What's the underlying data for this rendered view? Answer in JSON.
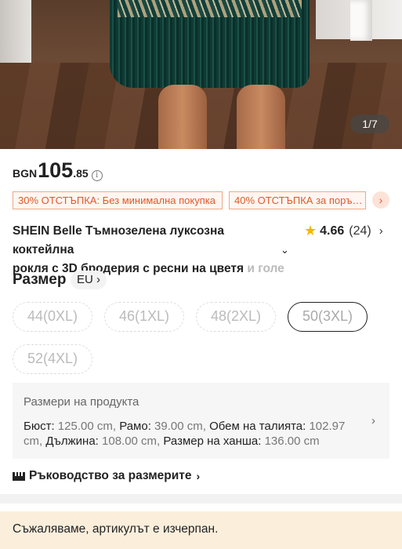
{
  "gallery": {
    "counter": "1/7"
  },
  "price": {
    "currency": "BGN",
    "main": "105",
    "decimal": ".85",
    "info_icon": "info-icon"
  },
  "promos": [
    "30% ОТСТЪПКА: Без минимална покупка",
    "40% ОТСТЪПКА за поръ…"
  ],
  "product": {
    "title_line1": "SHEIN Belle Тъмнозелена луксозна коктейлна",
    "title_line2_visible": "рокля с 3D бродерия с ресни на цветя",
    "title_line2_fade": " и голе",
    "rating": "4.66",
    "reviews": "(24)"
  },
  "size": {
    "label": "Размер",
    "unit": "EU",
    "options": [
      "44(0XL)",
      "46(1XL)",
      "48(2XL)",
      "50(3XL)",
      "52(4XL)"
    ],
    "selected_index": 3
  },
  "product_sizes": {
    "heading": "Размери на продукта",
    "bust_label": "Бюст:",
    "bust_value": " 125.00 cm, ",
    "shoulder_label": "Рамо:",
    "shoulder_value": " 39.00 cm, ",
    "waist_label": "Обем на талията:",
    "waist_value": " 102.97 cm, ",
    "length_label": "Дължина:",
    "length_value": " 108.00 cm, ",
    "hem_label": "Размер на ханша:",
    "hem_value": " 136.00 cm"
  },
  "size_guide": "Ръководство за размерите",
  "sold_out_notice": "Съжаляваме, артикулът е изчерпан.",
  "colors": {
    "promo": "#e0592b",
    "star": "#f7b500",
    "notice_bg": "#fbefdc"
  }
}
